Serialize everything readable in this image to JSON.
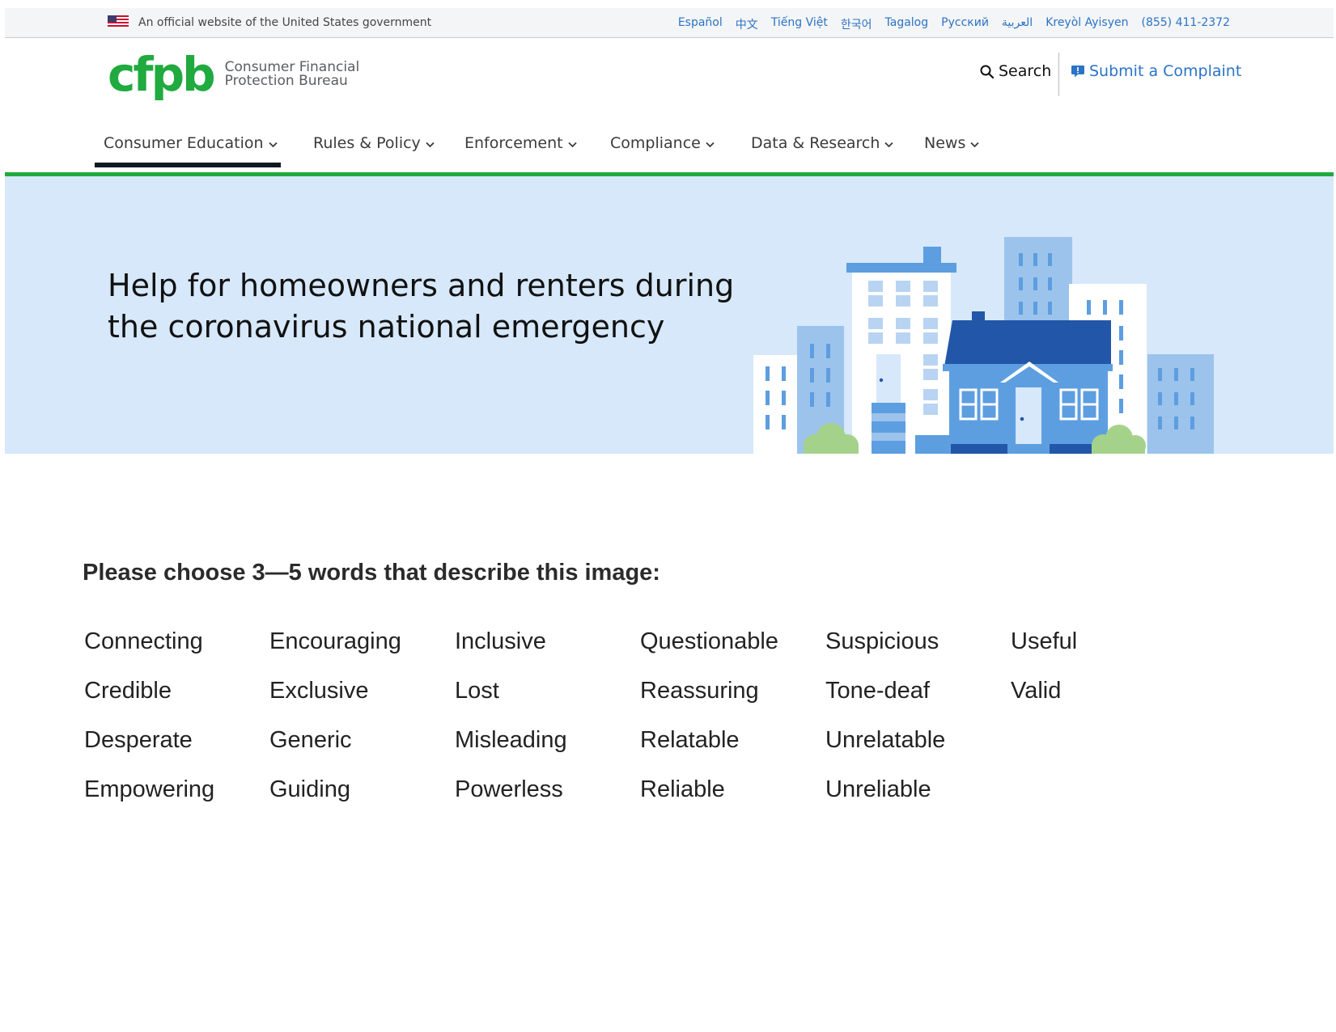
{
  "gov_banner": {
    "text": "An official website of the United States government",
    "languages": [
      "Español",
      "中文",
      "Tiếng Việt",
      "한국어",
      "Tagalog",
      "Русский",
      "العربية",
      "Kreyòl Ayisyen",
      "(855) 411-2372"
    ]
  },
  "logo": {
    "mark": "cfpb",
    "line1": "Consumer Financial",
    "line2": "Protection Bureau"
  },
  "header": {
    "search_label": "Search",
    "complaint_label": "Submit a Complaint"
  },
  "nav": {
    "items": [
      {
        "label": "Consumer Education",
        "active": true
      },
      {
        "label": "Rules & Policy"
      },
      {
        "label": "Enforcement"
      },
      {
        "label": "Compliance"
      },
      {
        "label": "Data & Research"
      },
      {
        "label": "News"
      }
    ]
  },
  "hero": {
    "line1": "Help for homeowners and renters during",
    "line2": "the coronavirus national emergency"
  },
  "survey": {
    "prompt": "Please choose 3—5 words that describe this image:",
    "columns": [
      [
        "Connecting",
        "Credible",
        "Desperate",
        "Empowering"
      ],
      [
        "Encouraging",
        "Exclusive",
        "Generic",
        "Guiding"
      ],
      [
        "Inclusive",
        "Lost",
        "Misleading",
        "Powerless"
      ],
      [
        "Questionable",
        "Reassuring",
        "Relatable",
        "Reliable"
      ],
      [
        "Suspicious",
        "Tone-deaf",
        "Unrelatable",
        "Unreliable"
      ],
      [
        "Useful",
        "Valid"
      ]
    ]
  },
  "colors": {
    "brand_green": "#20aa3f",
    "link_blue": "#2a73c6",
    "hero_bg": "#d6e8fa",
    "house_blue": "#2256a8"
  }
}
